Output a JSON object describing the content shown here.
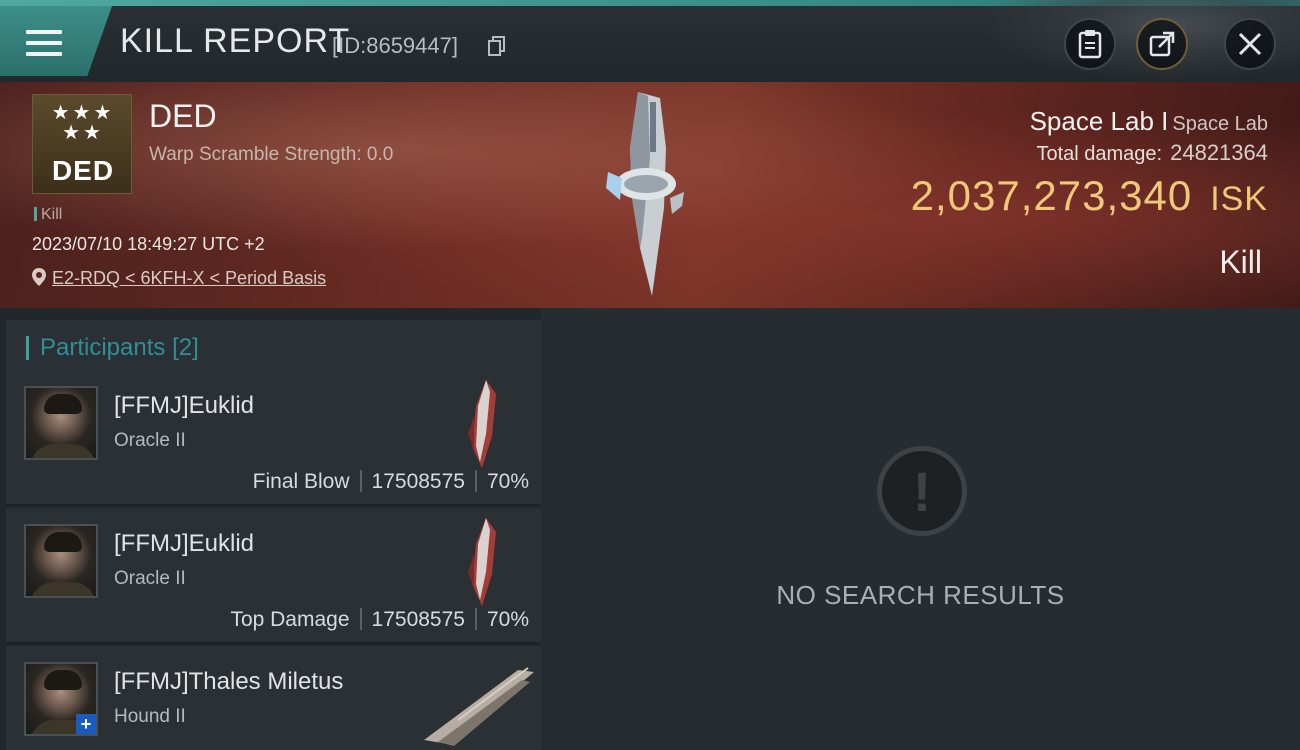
{
  "header": {
    "title": "KILL REPORT",
    "report_id": "[ID:8659447]",
    "menu_icon": "hamburger-menu-icon",
    "buttons": [
      "clipboard-icon",
      "share-icon",
      "close-icon"
    ]
  },
  "victim": {
    "badge_text": "DED",
    "name": "DED",
    "warp_scramble": "Warp Scramble Strength: 0.0",
    "tag": "Kill",
    "timestamp": "2023/07/10 18:49:27 UTC +2",
    "location": "E2-RDQ < 6KFH-X < Period Basis",
    "ship_name": "Space Lab I",
    "ship_class": "Space Lab",
    "total_damage_label": "Total damage:",
    "total_damage": "24821364",
    "isk_value": "2,037,273,340",
    "isk_currency": "ISK",
    "result": "Kill"
  },
  "participants": {
    "title": "Participants",
    "count": "[2]",
    "rows": [
      {
        "name": "[FFMJ]Euklid",
        "ship": "Oracle II",
        "role": "Final Blow",
        "damage": "17508575",
        "percent": "70%"
      },
      {
        "name": "[FFMJ]Euklid",
        "ship": "Oracle II",
        "role": "Top Damage",
        "damage": "17508575",
        "percent": "70%"
      },
      {
        "name": "[FFMJ]Thales Miletus",
        "ship": "Hound II"
      }
    ]
  },
  "right_panel": {
    "empty_icon": "exclamation-icon",
    "empty_text": "NO SEARCH RESULTS"
  },
  "colors": {
    "accent_teal": "#3fa0a0",
    "isk_gold": "#f0c879"
  }
}
